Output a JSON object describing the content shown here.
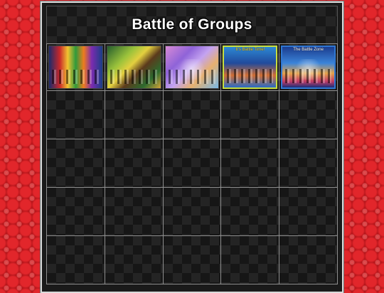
{
  "page": {
    "title": "Battle of Groups"
  },
  "thumbnails": [
    {
      "name": "group-poster-1",
      "caption": ""
    },
    {
      "name": "group-poster-2",
      "caption": ""
    },
    {
      "name": "group-poster-3",
      "caption": ""
    },
    {
      "name": "group-poster-4",
      "caption": "It's Battle Time!"
    },
    {
      "name": "group-poster-5",
      "caption": "The Battle Zone"
    }
  ],
  "grid": {
    "columns": 5,
    "rows": 5
  },
  "colors": {
    "background_red": "#c8141a",
    "panel_dark": "#181818",
    "grid_line": "#8e8e8e",
    "title_text": "#ffffff"
  }
}
